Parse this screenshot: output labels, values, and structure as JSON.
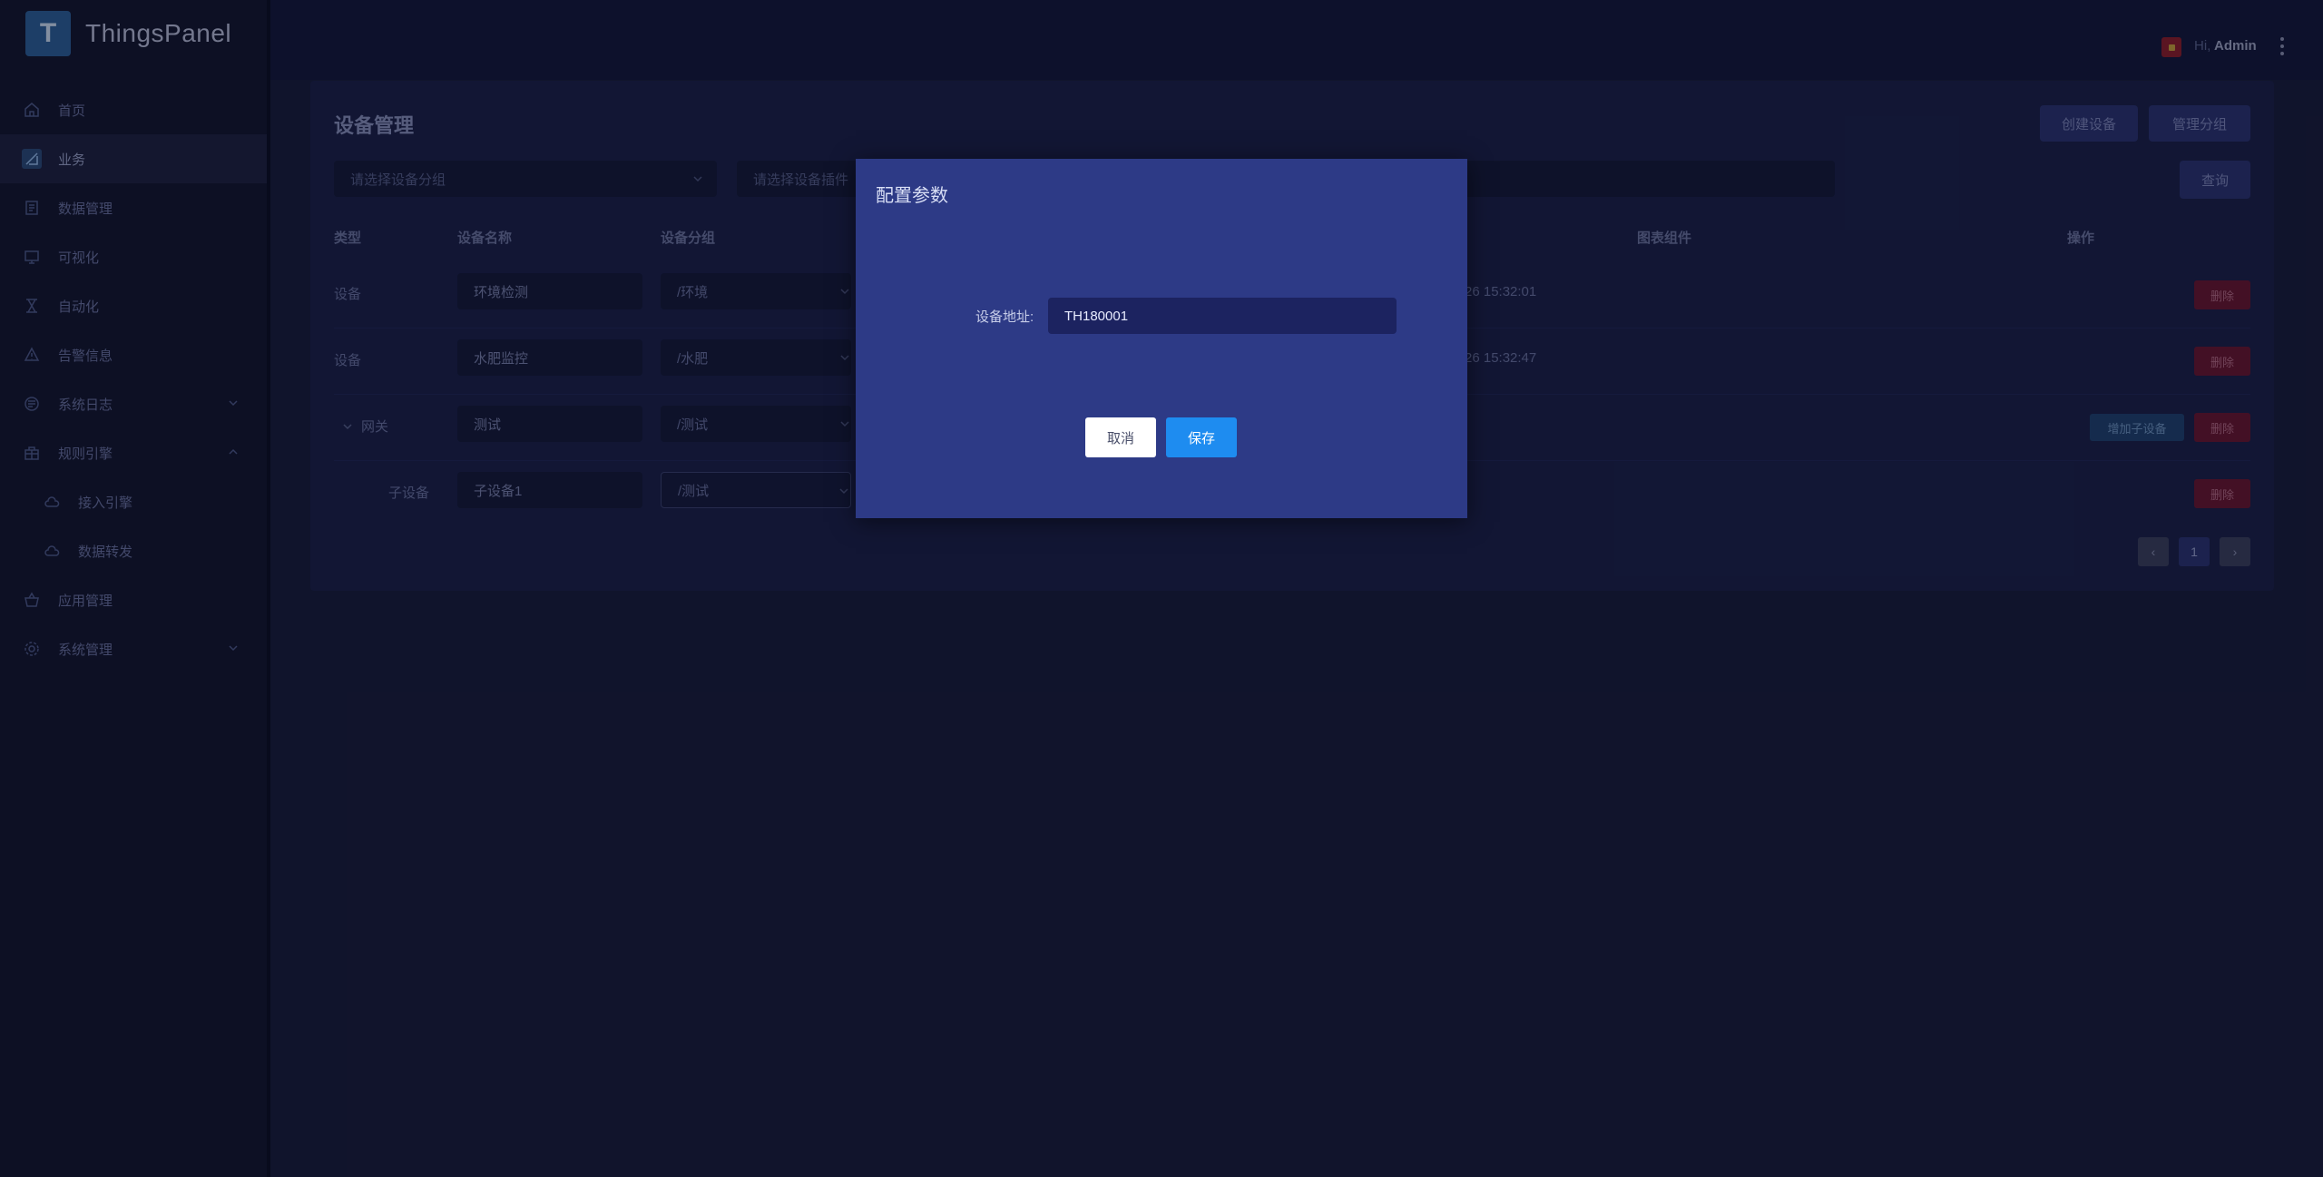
{
  "app": {
    "name": "ThingsPanel",
    "logo_letter": "T"
  },
  "sidebar": {
    "items": [
      {
        "label": "首页",
        "icon": "home-icon"
      },
      {
        "label": "业务",
        "icon": "business-icon",
        "active": true
      },
      {
        "label": "数据管理",
        "icon": "data-icon"
      },
      {
        "label": "可视化",
        "icon": "monitor-icon"
      },
      {
        "label": "自动化",
        "icon": "automation-icon"
      },
      {
        "label": "告警信息",
        "icon": "alert-icon"
      },
      {
        "label": "系统日志",
        "icon": "log-icon",
        "chevron": "down"
      },
      {
        "label": "规则引擎",
        "icon": "rule-icon",
        "chevron": "up"
      },
      {
        "label": "接入引擎",
        "icon": "cloud-icon",
        "sub": true
      },
      {
        "label": "数据转发",
        "icon": "cloud-icon",
        "sub": true
      },
      {
        "label": "应用管理",
        "icon": "app-icon"
      },
      {
        "label": "系统管理",
        "icon": "settings-icon",
        "chevron": "down"
      }
    ]
  },
  "header": {
    "greeting": "Hi,",
    "user": "Admin",
    "language_flag": "cn-flag-icon"
  },
  "page": {
    "title": "设备管理",
    "create_device": "创建设备",
    "manage_groups": "管理分组",
    "group_select_placeholder": "请选择设备分组",
    "plugin_select_placeholder": "请选择设备插件",
    "query": "查询"
  },
  "table": {
    "headers": {
      "type": "类型",
      "name": "设备名称",
      "group": "设备分组",
      "chart": "图表组件",
      "action": "操作"
    },
    "rows": [
      {
        "type": "设备",
        "name": "环境检测",
        "group": "/环境",
        "time": "26 15:32:01",
        "delete": "删除"
      },
      {
        "type": "设备",
        "name": "水肥监控",
        "group": "/水肥",
        "time": "26 15:32:47",
        "delete": "删除"
      },
      {
        "type": "网关",
        "name": "测试",
        "group": "/测试",
        "add_child": "增加子设备",
        "delete": "删除",
        "expandable": true
      },
      {
        "type": "子设备",
        "name": "子设备1",
        "group": "/测试",
        "delete": "删除"
      }
    ]
  },
  "pagination": {
    "prev": "‹",
    "current": "1",
    "next": "›"
  },
  "modal": {
    "title": "配置参数",
    "field_label": "设备地址:",
    "field_value": "TH180001",
    "cancel": "取消",
    "save": "保存"
  },
  "colors": {
    "accent": "#1e8cf0",
    "modal_bg": "#2d3a86",
    "danger": "#6a1530",
    "page_bg": "#171c3a"
  }
}
